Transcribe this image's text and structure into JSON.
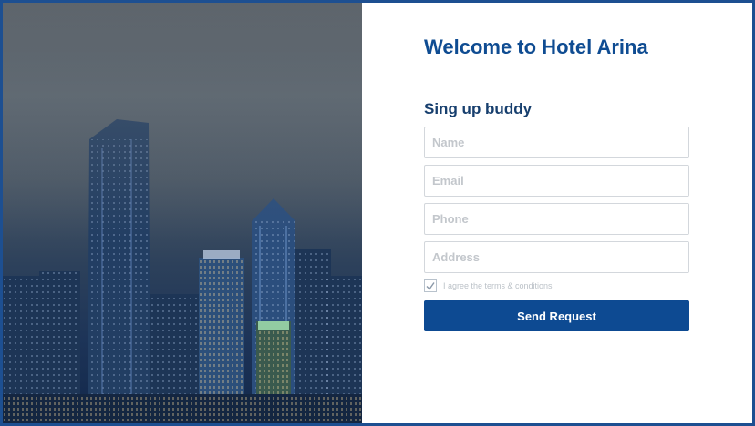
{
  "page": {
    "title": "Welcome to Hotel Arina",
    "hero_image": "city-skyline-night"
  },
  "form": {
    "heading": "Sing up buddy",
    "fields": [
      {
        "name": "name",
        "value": "",
        "placeholder": "Name"
      },
      {
        "name": "email",
        "value": "",
        "placeholder": "Email"
      },
      {
        "name": "phone",
        "value": "",
        "placeholder": "Phone"
      },
      {
        "name": "address",
        "value": "",
        "placeholder": "Address"
      }
    ],
    "agree": {
      "label": "I agree the terms & conditions",
      "checked": true,
      "icon": "check-icon"
    },
    "submit_label": "Send Request"
  },
  "colors": {
    "primary": "#0d4a92",
    "title": "#0f4c92",
    "border": "#1d4f91",
    "input_border": "#d3d7dc",
    "placeholder": "#c3c7cc"
  }
}
